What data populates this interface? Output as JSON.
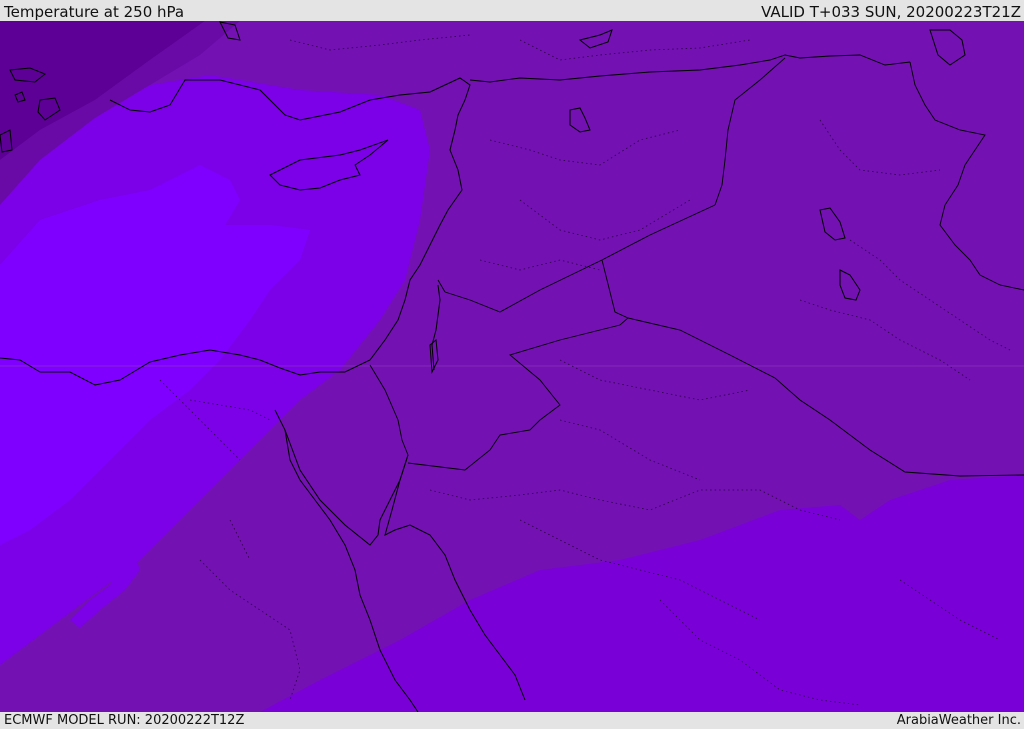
{
  "header": {
    "title": "Temperature at 250 hPa",
    "valid": "VALID T+033 SUN, 20200223T21Z"
  },
  "footer": {
    "model_run": "ECMWF MODEL RUN: 20200222T12Z",
    "credit": "ArabiaWeather Inc."
  },
  "map": {
    "colors": {
      "darkest": "#5c0096",
      "dark": "#6a0aa6",
      "mid": "#7311b3",
      "light": "#7a00d8",
      "lighter": "#7c00e8",
      "lightest": "#8000ff",
      "border": "#000000"
    }
  }
}
